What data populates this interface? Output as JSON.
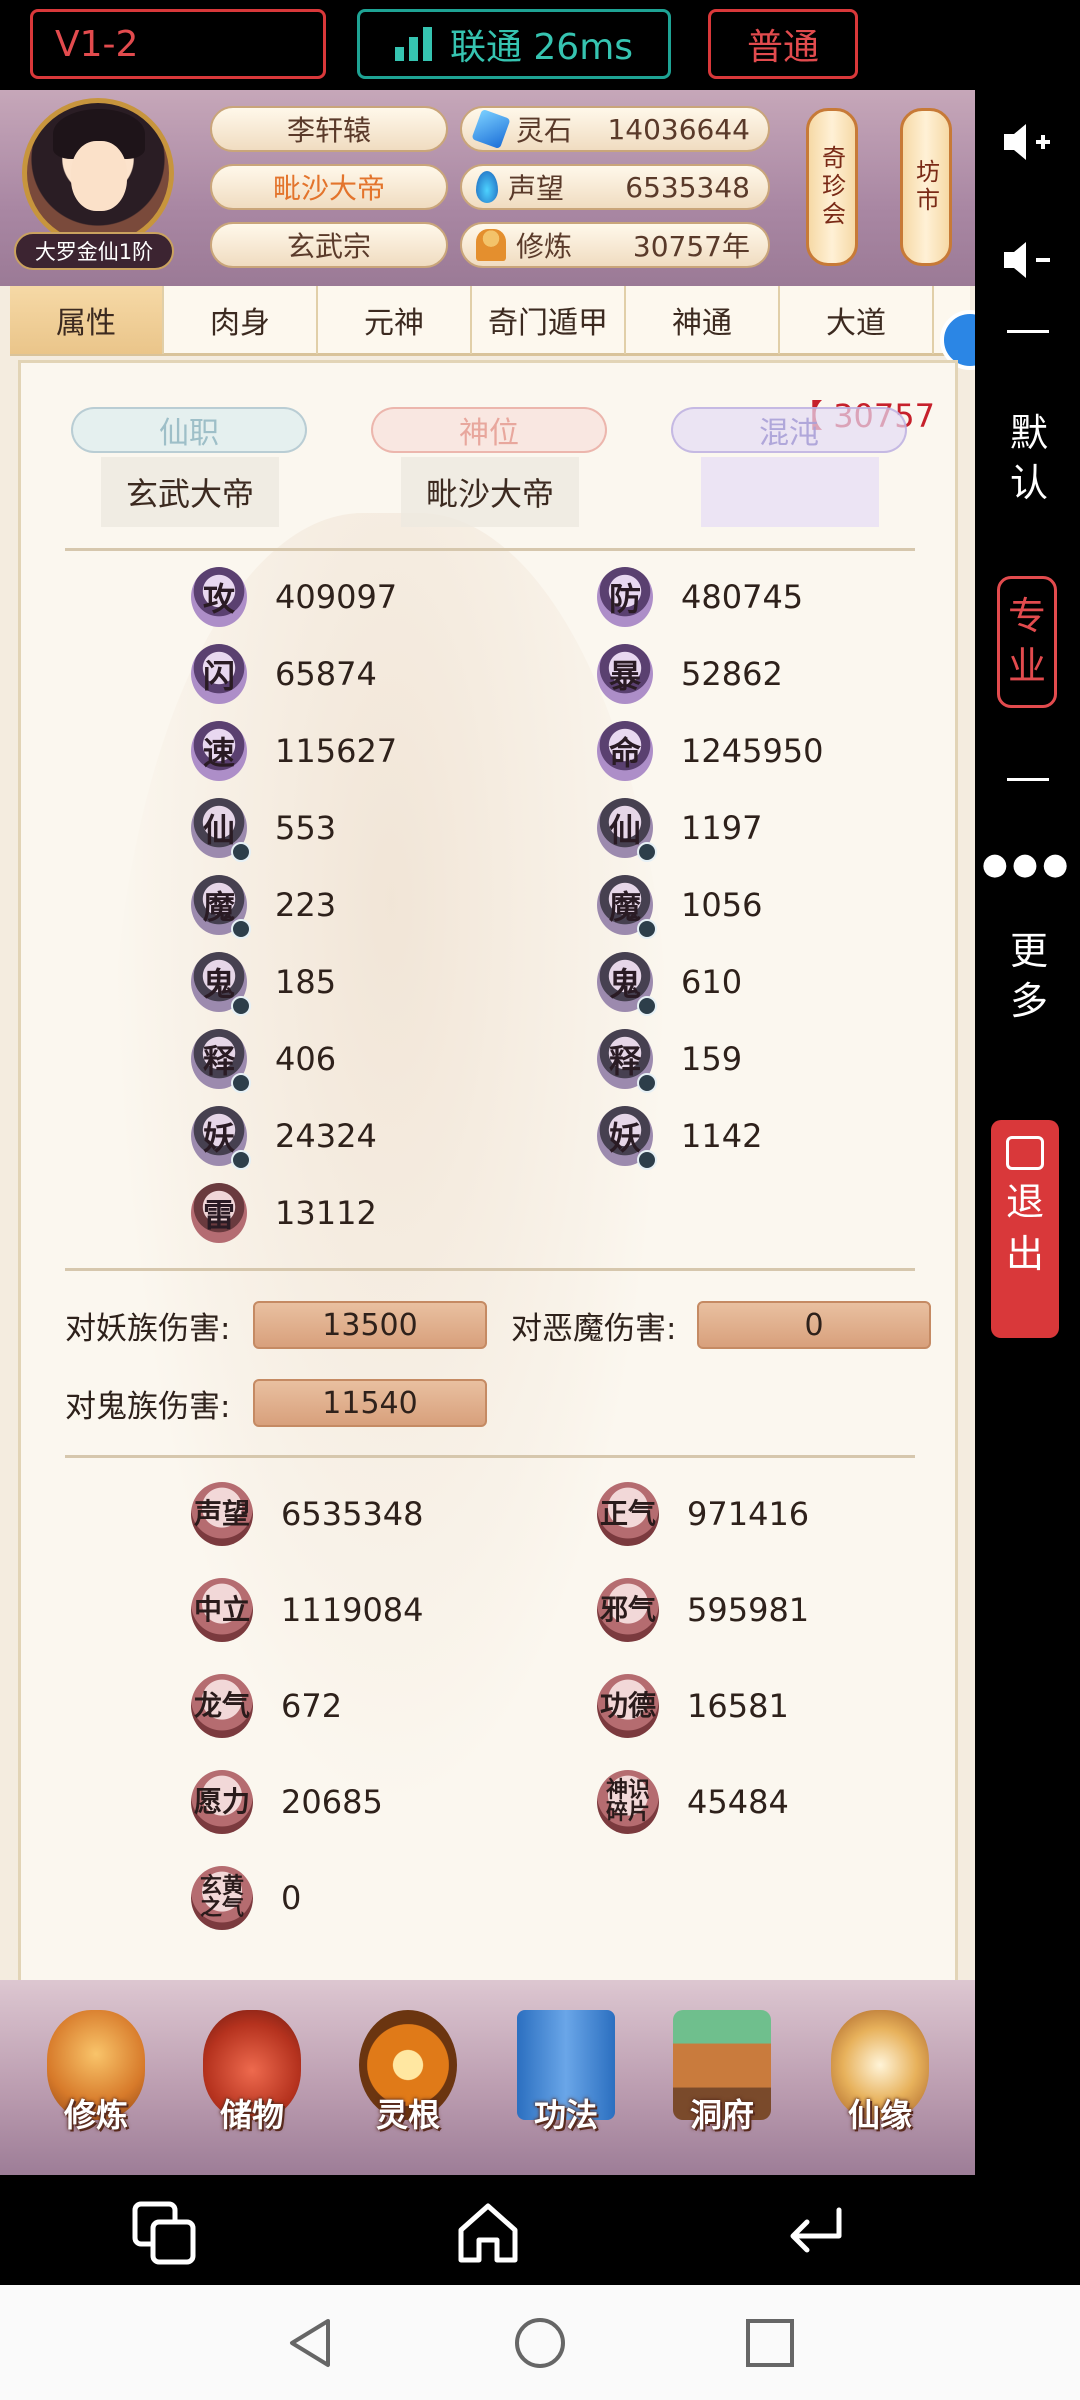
{
  "topbar": {
    "version": "V1-2",
    "network": "联通 26ms",
    "mode": "普通"
  },
  "header": {
    "rank": "大罗金仙1阶",
    "name": "李轩辕",
    "title": "毗沙大帝",
    "sect": "玄武宗",
    "resources": [
      {
        "icon": "spirit-stone-icon",
        "label": "灵石",
        "value": "14036644"
      },
      {
        "icon": "fame-icon",
        "label": "声望",
        "value": "6535348"
      },
      {
        "icon": "cultivation-icon",
        "label": "修炼",
        "value": "30757年"
      }
    ],
    "lanterns": [
      "奇珍会",
      "坊市"
    ]
  },
  "tabs": [
    "属性",
    "肉身",
    "元神",
    "奇门遁甲",
    "神通",
    "大道"
  ],
  "panel": {
    "counter": "【 30757",
    "positions": [
      {
        "label": "仙职",
        "value": "玄武大帝"
      },
      {
        "label": "神位",
        "value": "毗沙大帝"
      },
      {
        "label": "混沌",
        "value": ""
      }
    ],
    "stats_left": [
      {
        "glyph": "攻",
        "value": "409097"
      },
      {
        "glyph": "闪",
        "value": "65874"
      },
      {
        "glyph": "速",
        "value": "115627"
      },
      {
        "glyph": "仙",
        "value": "553"
      },
      {
        "glyph": "魔",
        "value": "223"
      },
      {
        "glyph": "鬼",
        "value": "185"
      },
      {
        "glyph": "释",
        "value": "406"
      },
      {
        "glyph": "妖",
        "value": "24324"
      },
      {
        "glyph": "雷",
        "value": "13112"
      }
    ],
    "stats_right": [
      {
        "glyph": "防",
        "value": "480745"
      },
      {
        "glyph": "暴",
        "value": "52862"
      },
      {
        "glyph": "命",
        "value": "1245950"
      },
      {
        "glyph": "仙",
        "value": "1197"
      },
      {
        "glyph": "魔",
        "value": "1056"
      },
      {
        "glyph": "鬼",
        "value": "610"
      },
      {
        "glyph": "释",
        "value": "159"
      },
      {
        "glyph": "妖",
        "value": "1142"
      }
    ],
    "damage": [
      {
        "label": "对妖族伤害:",
        "value": "13500"
      },
      {
        "label": "对恶魔伤害:",
        "value": "0"
      },
      {
        "label": "对鬼族伤害:",
        "value": "11540"
      }
    ],
    "resources_left": [
      {
        "glyph": "声望",
        "value": "6535348"
      },
      {
        "glyph": "中立",
        "value": "1119084"
      },
      {
        "glyph": "龙气",
        "value": "672"
      },
      {
        "glyph": "愿力",
        "value": "20685"
      },
      {
        "glyph": "玄黄之气",
        "value": "0"
      }
    ],
    "resources_right": [
      {
        "glyph": "正气",
        "value": "971416"
      },
      {
        "glyph": "邪气",
        "value": "595981"
      },
      {
        "glyph": "功德",
        "value": "16581"
      },
      {
        "glyph": "神识碎片",
        "value": "45484"
      }
    ]
  },
  "bottom_nav": [
    "修炼",
    "储物",
    "灵根",
    "功法",
    "洞府",
    "仙缘"
  ],
  "sidebar": {
    "default": "默认",
    "pro": "专业",
    "more": "更多",
    "exit": "退出"
  }
}
